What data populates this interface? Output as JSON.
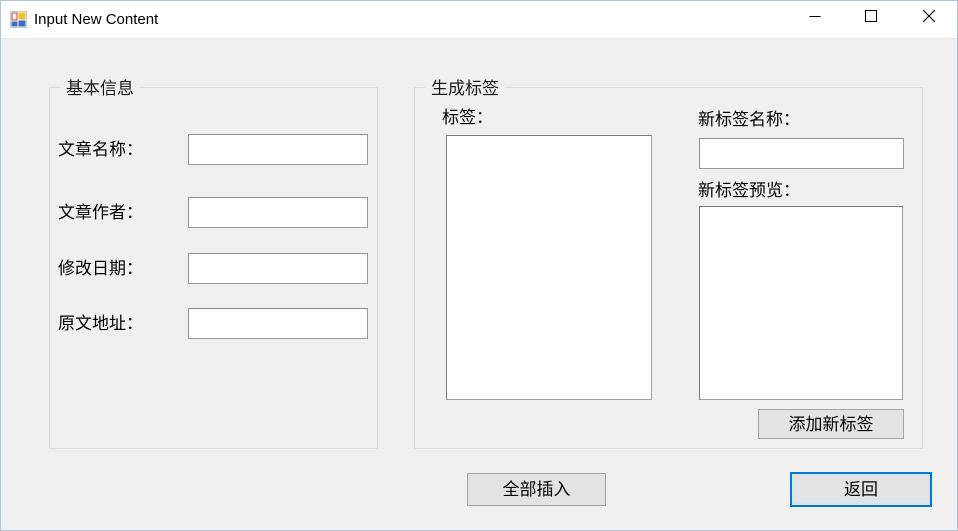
{
  "window": {
    "title": "Input New Content",
    "icon": "winforms-app-icon",
    "accent_color": "#0078d7",
    "background_color": "#f0f0f0",
    "titlebar_color": "#ffffff",
    "controls": {
      "minimize": "minimize-icon",
      "maximize": "maximize-icon",
      "close": "close-icon"
    }
  },
  "basic_info": {
    "group_title": "基本信息",
    "fields": [
      {
        "label": "文章名称：",
        "value": "",
        "placeholder": ""
      },
      {
        "label": "文章作者：",
        "value": "",
        "placeholder": ""
      },
      {
        "label": "修改日期：",
        "value": "",
        "placeholder": ""
      },
      {
        "label": "原文地址：",
        "value": "",
        "placeholder": ""
      }
    ]
  },
  "tags_panel": {
    "group_title": "生成标签",
    "tags_label": "标签：",
    "tags_list_items": [],
    "new_tag_name_label": "新标签名称：",
    "new_tag_name_value": "",
    "new_tag_preview_label": "新标签预览：",
    "new_tag_preview_value": "",
    "add_tag_button": "添加新标签"
  },
  "footer": {
    "insert_all_button": "全部插入",
    "return_button": "返回"
  }
}
